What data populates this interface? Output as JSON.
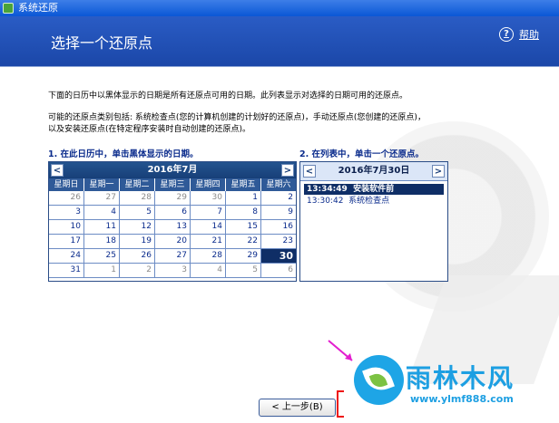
{
  "window": {
    "title": "系统还原"
  },
  "header": {
    "title": "选择一个还原点",
    "help_label": "帮助",
    "help_icon": "help-circle-icon"
  },
  "text": {
    "p1": "下面的日历中以黑体显示的日期是所有还原点可用的日期。此列表显示对选择的日期可用的还原点。",
    "p2_line1": "可能的还原点类别包括: 系统检查点(您的计算机创建的计划好的还原点)，手动还原点(您创建的还原点)，",
    "p2_line2": "以及安装还原点(在特定程序安装时自动创建的还原点)。",
    "step1": "1. 在此日历中，单击黑体显示的日期。",
    "step2": "2. 在列表中，单击一个还原点。"
  },
  "calendar": {
    "month_label": "2016年7月",
    "prev": "<",
    "next": ">",
    "days_of_week": [
      "星期日",
      "星期一",
      "星期二",
      "星期三",
      "星期四",
      "星期五",
      "星期六"
    ],
    "weeks": [
      [
        "26",
        "27",
        "28",
        "29",
        "30",
        "1",
        "2"
      ],
      [
        "3",
        "4",
        "5",
        "6",
        "7",
        "8",
        "9"
      ],
      [
        "10",
        "11",
        "12",
        "13",
        "14",
        "15",
        "16"
      ],
      [
        "17",
        "18",
        "19",
        "20",
        "21",
        "22",
        "23"
      ],
      [
        "24",
        "25",
        "26",
        "27",
        "28",
        "29",
        "30"
      ],
      [
        "31",
        "1",
        "2",
        "3",
        "4",
        "5",
        "6"
      ]
    ],
    "selected": "30"
  },
  "restore_list": {
    "date_label": "2016年7月30日",
    "prev": "<",
    "next": ">",
    "items": [
      {
        "time": "13:34:49",
        "name": "安装软件前",
        "selected": true
      },
      {
        "time": "13:30:42",
        "name": "系统检查点",
        "selected": false
      }
    ]
  },
  "buttons": {
    "back": "< 上一步(B)"
  },
  "watermark": {
    "brand": "雨林木风",
    "url": "www.ylmf888.com"
  },
  "colors": {
    "header_blue": "#1b47a8",
    "cal_head": "#24548f",
    "selected_bg": "#0f2e66",
    "brand": "#1d9fe2",
    "annotation_red": "#e11111"
  }
}
